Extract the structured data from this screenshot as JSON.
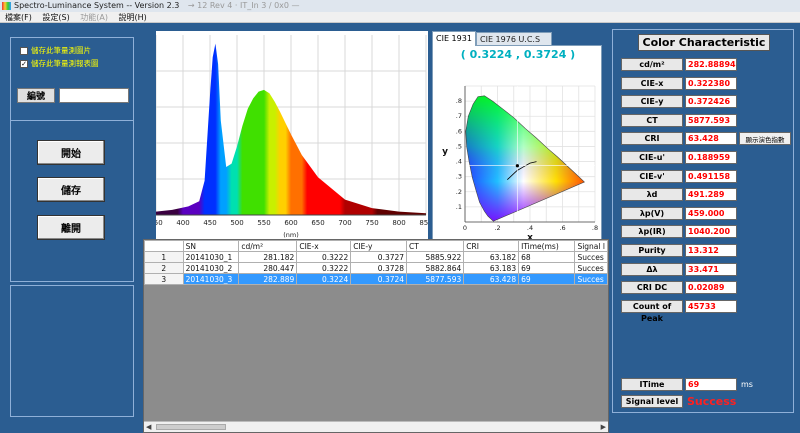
{
  "window": {
    "title": "Spectro-Luminance System -- Version 2.3",
    "ghost_title": "→ 12 Rev 4 · IT_In 3 / 0x0 —"
  },
  "menu": [
    {
      "label": "檔案(F)",
      "enabled": true
    },
    {
      "label": "設定(S)",
      "enabled": true
    },
    {
      "label": "功能(A)",
      "enabled": false
    },
    {
      "label": "說明(H)",
      "enabled": true
    }
  ],
  "options": {
    "save_image_label": "儲存此筆量測圖片",
    "save_image_checked": false,
    "save_report_label": "儲存此筆量測報表圖",
    "save_report_checked": true,
    "serial_button": "編號",
    "serial_value": ""
  },
  "actions": {
    "start": "開始",
    "save": "儲存",
    "exit": "離開"
  },
  "spectrum": {
    "x_ticks": [
      "350",
      "400",
      "450",
      "500",
      "550",
      "600",
      "650",
      "700",
      "750",
      "800",
      "850"
    ],
    "x_unit": "(nm)"
  },
  "cie": {
    "tabs": [
      "CIE 1931",
      "CIE 1976 U.C.S"
    ],
    "active_tab": 0,
    "readout": "( 0.3224 , 0.3724 )",
    "x_label": "x",
    "y_label": "y",
    "x_ticks": [
      "0",
      ".2",
      ".4",
      ".6",
      ".8"
    ],
    "y_ticks": [
      ".8",
      ".7",
      ".6",
      ".5",
      ".4",
      ".3",
      ".2",
      ".1"
    ],
    "point": {
      "x": 0.3224,
      "y": 0.3724
    }
  },
  "table": {
    "columns": [
      "",
      "SN",
      "cd/m²",
      "CIE-x",
      "CIE-y",
      "CT",
      "CRI",
      "ITime(ms)",
      "Signal l"
    ],
    "rows": [
      {
        "n": "1",
        "sn": "20141030_1",
        "cd": "281.182",
        "x": "0.3222",
        "y": "0.3727",
        "ct": "5885.922",
        "cri": "63.182",
        "itime": "68",
        "signal": "Succes"
      },
      {
        "n": "2",
        "sn": "20141030_2",
        "cd": "280.447",
        "x": "0.3222",
        "y": "0.3728",
        "ct": "5882.864",
        "cri": "63.183",
        "itime": "69",
        "signal": "Succes"
      },
      {
        "n": "3",
        "sn": "20141030_3",
        "cd": "282.889",
        "x": "0.3224",
        "y": "0.3724",
        "ct": "5877.593",
        "cri": "63.428",
        "itime": "69",
        "signal": "Succes"
      }
    ],
    "selected_row": 2
  },
  "color_characteristic": {
    "title": "Color Characteristic",
    "rows": [
      {
        "label": "cd/m²",
        "value": "282.88894"
      },
      {
        "label": "CIE-x",
        "value": "0.322380"
      },
      {
        "label": "CIE-y",
        "value": "0.372426"
      },
      {
        "label": "CT",
        "value": "5877.593"
      },
      {
        "label": "CRI",
        "value": "63.428"
      },
      {
        "label": "CIE-u'",
        "value": "0.188959"
      },
      {
        "label": "CIE-v'",
        "value": "0.491158"
      },
      {
        "label": "λd",
        "value": "491.289"
      },
      {
        "label": "λp(V)",
        "value": "459.000"
      },
      {
        "label": "λp(IR)",
        "value": "1040.200"
      },
      {
        "label": "Purity",
        "value": "13.312"
      },
      {
        "label": "Δλ",
        "value": "33.471"
      },
      {
        "label": "CRI DC",
        "value": "0.02089"
      },
      {
        "label": "Count of Peak",
        "value": "45733"
      }
    ],
    "cri_button": "顯示演色指數",
    "itime_label": "ITime",
    "itime_value": "69",
    "itime_unit": "ms",
    "signal_label": "Signal level",
    "signal_value": "Success"
  },
  "colors": {
    "background": "#2b5d91",
    "value_text": "#ff0000",
    "readout": "#00b0c0",
    "selection": "#3399ff"
  },
  "chart_data": [
    {
      "type": "area",
      "x": [
        350,
        380,
        410,
        430,
        440,
        450,
        455,
        460,
        465,
        470,
        480,
        490,
        500,
        510,
        520,
        530,
        540,
        550,
        555,
        560,
        570,
        580,
        600,
        620,
        650,
        700,
        750,
        800,
        850
      ],
      "y": [
        0.02,
        0.03,
        0.05,
        0.08,
        0.2,
        0.7,
        0.92,
        1.0,
        0.88,
        0.55,
        0.28,
        0.3,
        0.4,
        0.52,
        0.62,
        0.68,
        0.72,
        0.73,
        0.72,
        0.71,
        0.66,
        0.6,
        0.47,
        0.35,
        0.22,
        0.09,
        0.04,
        0.02,
        0.01
      ],
      "xlim": [
        350,
        850
      ],
      "ylim": [
        0,
        1.05
      ],
      "grid": true,
      "fill": "spectral"
    },
    {
      "type": "scatter",
      "x": [
        0.3224
      ],
      "y": [
        0.3724
      ],
      "xlim": [
        0,
        0.8
      ],
      "ylim": [
        0,
        0.9
      ],
      "xlabel": "x",
      "ylabel": "y",
      "grid": true
    }
  ]
}
